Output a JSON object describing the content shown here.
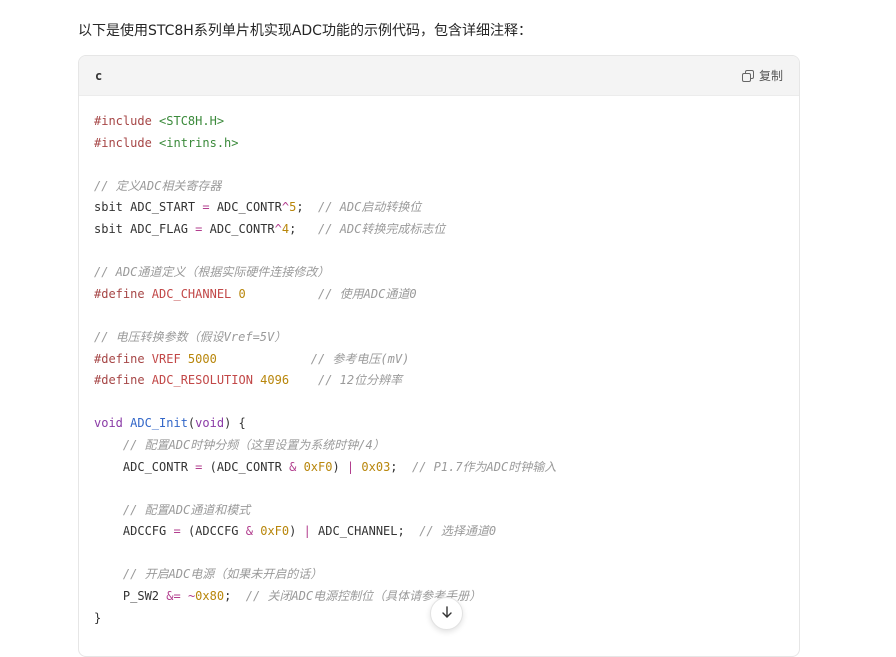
{
  "intro_text": "以下是使用STC8H系列单片机实现ADC功能的示例代码，包含详细注释：",
  "code_block": {
    "language": "c",
    "copy_label": "复制",
    "lines": [
      [
        {
          "t": "#include ",
          "c": "kw-pre"
        },
        {
          "t": "<STC8H.H>",
          "c": "str"
        }
      ],
      [
        {
          "t": "#include ",
          "c": "kw-pre"
        },
        {
          "t": "<intrins.h>",
          "c": "str"
        }
      ],
      [],
      [
        {
          "t": "// 定义ADC相关寄存器",
          "c": "cmt"
        }
      ],
      [
        {
          "t": "sbit ADC_START "
        },
        {
          "t": "=",
          "c": "op"
        },
        {
          "t": " ADC_CONTR"
        },
        {
          "t": "^",
          "c": "op"
        },
        {
          "t": "5",
          "c": "num"
        },
        {
          "t": ";  "
        },
        {
          "t": "// ADC启动转换位",
          "c": "cmt"
        }
      ],
      [
        {
          "t": "sbit ADC_FLAG "
        },
        {
          "t": "=",
          "c": "op"
        },
        {
          "t": " ADC_CONTR"
        },
        {
          "t": "^",
          "c": "op"
        },
        {
          "t": "4",
          "c": "num"
        },
        {
          "t": ";   "
        },
        {
          "t": "// ADC转换完成标志位",
          "c": "cmt"
        }
      ],
      [],
      [
        {
          "t": "// ADC通道定义（根据实际硬件连接修改）",
          "c": "cmt"
        }
      ],
      [
        {
          "t": "#define ",
          "c": "kw-pre"
        },
        {
          "t": "ADC_CHANNEL ",
          "c": "macro"
        },
        {
          "t": "0",
          "c": "num"
        },
        {
          "t": "          "
        },
        {
          "t": "// 使用ADC通道0",
          "c": "cmt"
        }
      ],
      [],
      [
        {
          "t": "// 电压转换参数（假设Vref=5V）",
          "c": "cmt"
        }
      ],
      [
        {
          "t": "#define ",
          "c": "kw-pre"
        },
        {
          "t": "VREF ",
          "c": "macro"
        },
        {
          "t": "5000",
          "c": "num"
        },
        {
          "t": "             "
        },
        {
          "t": "// 参考电压(mV)",
          "c": "cmt"
        }
      ],
      [
        {
          "t": "#define ",
          "c": "kw-pre"
        },
        {
          "t": "ADC_RESOLUTION ",
          "c": "macro"
        },
        {
          "t": "4096",
          "c": "num"
        },
        {
          "t": "    "
        },
        {
          "t": "// 12位分辨率",
          "c": "cmt"
        }
      ],
      [],
      [
        {
          "t": "void ",
          "c": "type"
        },
        {
          "t": "ADC_Init",
          "c": "fn"
        },
        {
          "t": "("
        },
        {
          "t": "void",
          "c": "type"
        },
        {
          "t": ") {"
        }
      ],
      [
        {
          "t": "    "
        },
        {
          "t": "// 配置ADC时钟分频（这里设置为系统时钟/4）",
          "c": "cmt"
        }
      ],
      [
        {
          "t": "    ADC_CONTR "
        },
        {
          "t": "=",
          "c": "op"
        },
        {
          "t": " (ADC_CONTR "
        },
        {
          "t": "&",
          "c": "op"
        },
        {
          "t": " "
        },
        {
          "t": "0xF0",
          "c": "num"
        },
        {
          "t": ") "
        },
        {
          "t": "|",
          "c": "op"
        },
        {
          "t": " "
        },
        {
          "t": "0x03",
          "c": "num"
        },
        {
          "t": ";  "
        },
        {
          "t": "// P1.7作为ADC时钟输入",
          "c": "cmt"
        }
      ],
      [],
      [
        {
          "t": "    "
        },
        {
          "t": "// 配置ADC通道和模式",
          "c": "cmt"
        }
      ],
      [
        {
          "t": "    ADCCFG "
        },
        {
          "t": "=",
          "c": "op"
        },
        {
          "t": " (ADCCFG "
        },
        {
          "t": "&",
          "c": "op"
        },
        {
          "t": " "
        },
        {
          "t": "0xF0",
          "c": "num"
        },
        {
          "t": ") "
        },
        {
          "t": "|",
          "c": "op"
        },
        {
          "t": " ADC_CHANNEL;  "
        },
        {
          "t": "// 选择通道0",
          "c": "cmt"
        }
      ],
      [],
      [
        {
          "t": "    "
        },
        {
          "t": "// 开启ADC电源（如果未开启的话）",
          "c": "cmt"
        }
      ],
      [
        {
          "t": "    P_SW2 "
        },
        {
          "t": "&=",
          "c": "op"
        },
        {
          "t": " "
        },
        {
          "t": "~",
          "c": "op"
        },
        {
          "t": "0x80",
          "c": "num"
        },
        {
          "t": ";  "
        },
        {
          "t": "// 关闭ADC电源控制位（具体请参考手册）",
          "c": "cmt"
        }
      ],
      [
        {
          "t": "}"
        }
      ]
    ]
  },
  "colors": {
    "background": "#ffffff",
    "header_bg": "#f4f4f4",
    "comment": "#9a9a9a",
    "number": "#b8860b",
    "string": "#3b8a3b",
    "preprocessor": "#a64646"
  },
  "icons": {
    "copy": "copy-icon",
    "scroll_down": "arrow-down-icon"
  }
}
